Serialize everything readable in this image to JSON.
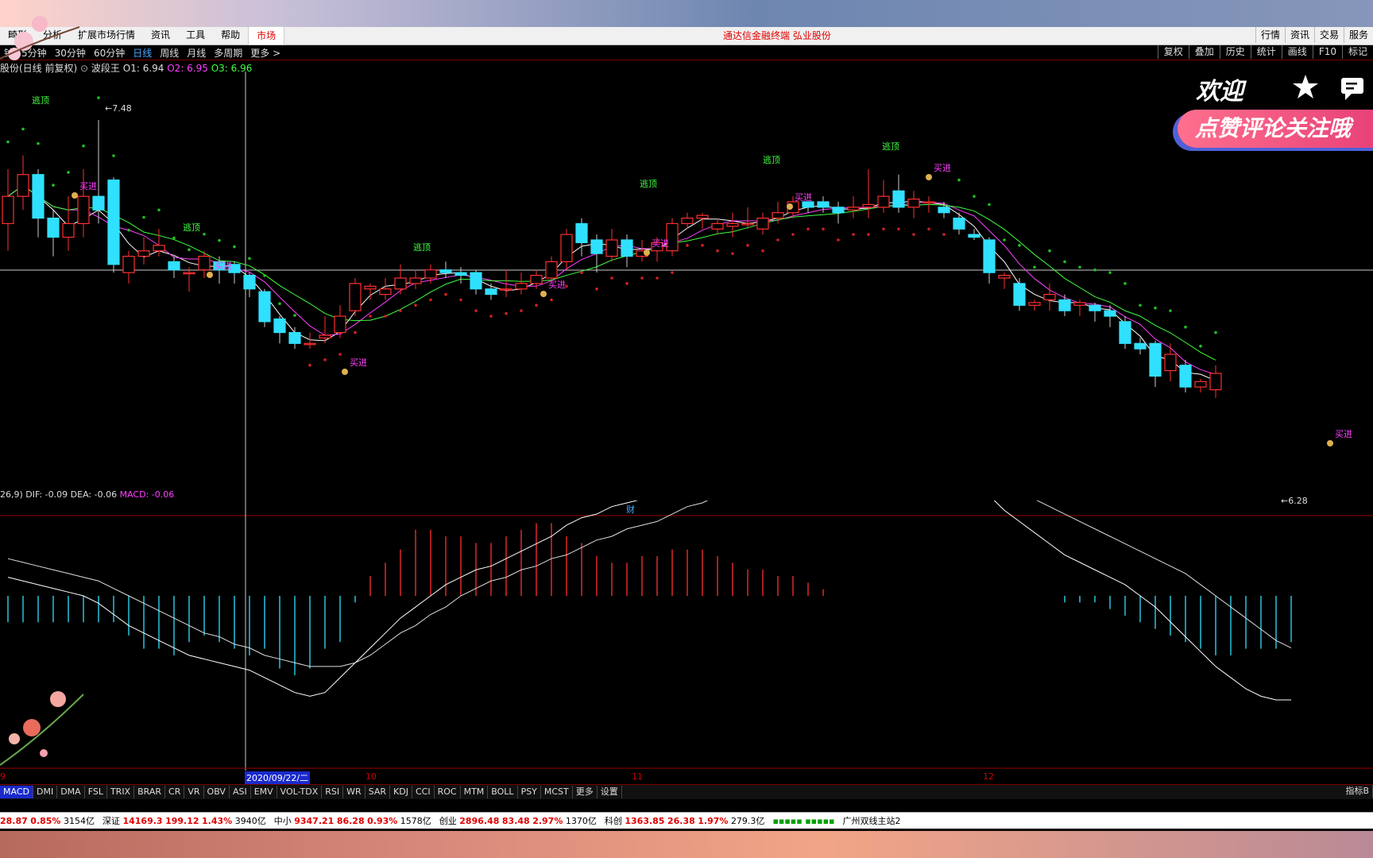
{
  "app": {
    "menu": [
      "系统",
      "分析",
      "扩展市场行情",
      "资讯",
      "工具",
      "帮助",
      "市场"
    ],
    "menu_visible": [
      "畸形",
      "分析",
      "扩展市场行情",
      "资讯",
      "工具",
      "帮助",
      "市场"
    ],
    "center_title": "通达信金融终端 弘业股份",
    "right_menu": [
      "行情",
      "资讯",
      "交易",
      "服务"
    ]
  },
  "periodbar": {
    "periods": [
      "1分钟",
      "5分钟",
      "30分钟",
      "60分钟",
      "日线",
      "周线",
      "月线",
      "多周期",
      "更多 >"
    ],
    "periods_visible": [
      "钟",
      "5分钟",
      "30分钟",
      "60分钟",
      "日线",
      "周线",
      "月线",
      "多周期",
      "更多 >"
    ],
    "active": "日线",
    "right": [
      "复权",
      "叠加",
      "历史",
      "统计",
      "画线",
      "F10",
      "标记"
    ]
  },
  "info": {
    "name": "股份(日线 前复权)",
    "indicator": "波段王",
    "o1_label": "O1: 6.94",
    "o2_label": "O2: 6.95",
    "o3_label": "O3: 6.96"
  },
  "chart_annotations": {
    "high_label": "7.48",
    "low_label": "6.28",
    "escape_top": "逃顶",
    "buy_in": "买进",
    "finance_marker": "财"
  },
  "macd": {
    "params": "26,9)",
    "dif": "DIF: -0.09",
    "dea": "DEA: -0.06",
    "macd": "MACD: -0.06"
  },
  "dates": {
    "selected": "2020/09/22/二",
    "month_10": "10",
    "month_11": "11",
    "month_12": "12",
    "left": "9"
  },
  "indicator_tabs": [
    "MACD",
    "DMI",
    "DMA",
    "FSL",
    "TRIX",
    "BRAR",
    "CR",
    "VR",
    "OBV",
    "ASI",
    "EMV",
    "VOL-TDX",
    "RSI",
    "WR",
    "SAR",
    "KDJ",
    "CCI",
    "ROC",
    "MTM",
    "BOLL",
    "PSY",
    "MCST",
    "更多",
    "设置"
  ],
  "indicator_active": "MACD",
  "indicator_right": "指标B",
  "status": [
    {
      "name": "",
      "value": "28.87",
      "pct": "0.85%",
      "amt": "3154亿"
    },
    {
      "name": "深证",
      "value": "14169.3",
      "chg": "199.12",
      "pct": "1.43%",
      "amt": "3940亿"
    },
    {
      "name": "中小",
      "value": "9347.21",
      "chg": "86.28",
      "pct": "0.93%",
      "amt": "1578亿"
    },
    {
      "name": "创业",
      "value": "2896.48",
      "chg": "83.48",
      "pct": "2.97%",
      "amt": "1370亿"
    },
    {
      "name": "科创",
      "value": "1363.85",
      "chg": "26.38",
      "pct": "1.97%",
      "amt": "279.3亿"
    }
  ],
  "status_site": "广州双线主站2",
  "overlay": {
    "welcome": "欢迎",
    "banner": "点赞评论关注哦"
  },
  "colors": {
    "up": "#ff3030",
    "down": "#30e0ff",
    "ma_white": "#ffffff",
    "ma_magenta": "#ff40ff",
    "ma_green": "#40ff40",
    "sar_green": "#20c020",
    "sar_red": "#d02020"
  },
  "chart_data": {
    "type": "candlestick",
    "price_range": [
      6.28,
      7.48
    ],
    "candles": [
      [
        7.1,
        7.2,
        7.0,
        7.3
      ],
      [
        7.2,
        7.28,
        7.15,
        7.35
      ],
      [
        7.28,
        7.12,
        7.05,
        7.3
      ],
      [
        7.12,
        7.05,
        6.98,
        7.15
      ],
      [
        7.05,
        7.1,
        7.0,
        7.2
      ],
      [
        7.1,
        7.2,
        7.05,
        7.3
      ],
      [
        7.2,
        7.15,
        7.1,
        7.48
      ],
      [
        7.26,
        6.95,
        6.92,
        7.27
      ],
      [
        6.92,
        6.98,
        6.88,
        7.0
      ],
      [
        6.98,
        7.0,
        6.95,
        7.05
      ],
      [
        7.0,
        7.02,
        6.98,
        7.08
      ],
      [
        6.96,
        6.93,
        6.9,
        6.98
      ],
      [
        6.92,
        6.92,
        6.85,
        6.94
      ],
      [
        6.93,
        6.98,
        6.9,
        7.0
      ],
      [
        6.96,
        6.93,
        6.88,
        6.98
      ],
      [
        6.95,
        6.92,
        6.88,
        6.96
      ],
      [
        6.91,
        6.86,
        6.83,
        6.92
      ],
      [
        6.85,
        6.74,
        6.72,
        6.86
      ],
      [
        6.75,
        6.7,
        6.66,
        6.76
      ],
      [
        6.7,
        6.66,
        6.64,
        6.72
      ],
      [
        6.66,
        6.66,
        6.64,
        6.7
      ],
      [
        6.68,
        6.69,
        6.66,
        6.76
      ],
      [
        6.7,
        6.76,
        6.68,
        6.8
      ],
      [
        6.78,
        6.88,
        6.76,
        6.9
      ],
      [
        6.86,
        6.87,
        6.82,
        6.88
      ],
      [
        6.84,
        6.86,
        6.82,
        6.9
      ],
      [
        6.86,
        6.9,
        6.84,
        6.95
      ],
      [
        6.88,
        6.9,
        6.86,
        6.93
      ],
      [
        6.9,
        6.93,
        6.88,
        6.95
      ],
      [
        6.93,
        6.92,
        6.9,
        6.96
      ],
      [
        6.92,
        6.91,
        6.88,
        6.94
      ],
      [
        6.92,
        6.86,
        6.84,
        6.93
      ],
      [
        6.86,
        6.84,
        6.82,
        6.88
      ],
      [
        6.86,
        6.86,
        6.83,
        6.93
      ],
      [
        6.86,
        6.88,
        6.84,
        6.92
      ],
      [
        6.88,
        6.91,
        6.86,
        6.93
      ],
      [
        6.9,
        6.96,
        6.88,
        6.98
      ],
      [
        6.96,
        7.06,
        6.93,
        7.08
      ],
      [
        7.1,
        7.03,
        6.98,
        7.12
      ],
      [
        7.04,
        6.99,
        6.92,
        7.06
      ],
      [
        6.98,
        7.04,
        6.96,
        7.08
      ],
      [
        7.04,
        6.98,
        6.94,
        7.06
      ],
      [
        6.98,
        7.0,
        6.96,
        7.04
      ],
      [
        7.0,
        7.03,
        6.96,
        7.05
      ],
      [
        7.0,
        7.1,
        6.98,
        7.12
      ],
      [
        7.1,
        7.12,
        7.08,
        7.14
      ],
      [
        7.12,
        7.13,
        7.08,
        7.14
      ],
      [
        7.08,
        7.1,
        7.06,
        7.12
      ],
      [
        7.09,
        7.1,
        7.05,
        7.14
      ],
      [
        7.1,
        7.1,
        7.08,
        7.16
      ],
      [
        7.08,
        7.12,
        7.06,
        7.14
      ],
      [
        7.12,
        7.14,
        7.1,
        7.18
      ],
      [
        7.14,
        7.18,
        7.12,
        7.2
      ],
      [
        7.18,
        7.16,
        7.14,
        7.18
      ],
      [
        7.18,
        7.16,
        7.14,
        7.2
      ],
      [
        7.16,
        7.14,
        7.1,
        7.18
      ],
      [
        7.15,
        7.16,
        7.12,
        7.2
      ],
      [
        7.16,
        7.17,
        7.12,
        7.3
      ],
      [
        7.16,
        7.2,
        7.14,
        7.26
      ],
      [
        7.22,
        7.16,
        7.14,
        7.28
      ],
      [
        7.16,
        7.19,
        7.12,
        7.22
      ],
      [
        7.18,
        7.18,
        7.14,
        7.2
      ],
      [
        7.16,
        7.14,
        7.12,
        7.18
      ],
      [
        7.12,
        7.08,
        7.06,
        7.14
      ],
      [
        7.06,
        7.05,
        7.04,
        7.08
      ],
      [
        7.04,
        6.92,
        6.88,
        7.05
      ],
      [
        6.9,
        6.91,
        6.86,
        6.92
      ],
      [
        6.88,
        6.8,
        6.78,
        6.9
      ],
      [
        6.8,
        6.81,
        6.78,
        6.82
      ],
      [
        6.82,
        6.84,
        6.78,
        6.88
      ],
      [
        6.82,
        6.78,
        6.76,
        6.84
      ],
      [
        6.8,
        6.81,
        6.76,
        6.82
      ],
      [
        6.8,
        6.78,
        6.74,
        6.81
      ],
      [
        6.78,
        6.76,
        6.72,
        6.8
      ],
      [
        6.74,
        6.66,
        6.64,
        6.76
      ],
      [
        6.66,
        6.64,
        6.62,
        6.68
      ],
      [
        6.66,
        6.54,
        6.5,
        6.67
      ],
      [
        6.56,
        6.62,
        6.52,
        6.66
      ],
      [
        6.58,
        6.5,
        6.48,
        6.6
      ],
      [
        6.5,
        6.52,
        6.48,
        6.53
      ],
      [
        6.49,
        6.55,
        6.46,
        6.58
      ]
    ],
    "macd_hist": [
      -0.04,
      -0.04,
      -0.04,
      -0.04,
      -0.04,
      -0.04,
      -0.04,
      -0.04,
      -0.06,
      -0.08,
      -0.08,
      -0.09,
      -0.07,
      -0.06,
      -0.07,
      -0.08,
      -0.09,
      -0.08,
      -0.11,
      -0.12,
      -0.11,
      -0.08,
      -0.07,
      -0.01,
      0.03,
      0.05,
      0.07,
      0.1,
      0.1,
      0.09,
      0.09,
      0.08,
      0.08,
      0.09,
      0.1,
      0.11,
      0.11,
      0.09,
      0.08,
      0.06,
      0.05,
      0.05,
      0.06,
      0.06,
      0.07,
      0.07,
      0.07,
      0.06,
      0.05,
      0.04,
      0.04,
      0.03,
      0.03,
      0.02,
      0.01,
      0.0,
      0.0,
      0.0,
      0.0,
      0.0,
      0.0,
      0.0,
      0.0,
      0.0,
      0.0,
      0.0,
      0.0,
      0.0,
      0.0,
      0.0,
      -0.01,
      -0.01,
      -0.01,
      -0.02,
      -0.03,
      -0.04,
      -0.05,
      -0.06,
      -0.07,
      -0.08,
      -0.09,
      -0.09,
      -0.08,
      -0.08,
      -0.08,
      -0.07
    ],
    "dif": [
      0.05,
      0.04,
      0.03,
      0.02,
      0.01,
      0.0,
      -0.02,
      -0.05,
      -0.08,
      -0.1,
      -0.12,
      -0.14,
      -0.16,
      -0.17,
      -0.18,
      -0.19,
      -0.2,
      -0.22,
      -0.24,
      -0.26,
      -0.27,
      -0.26,
      -0.22,
      -0.18,
      -0.14,
      -0.1,
      -0.06,
      -0.03,
      0.0,
      0.03,
      0.05,
      0.07,
      0.08,
      0.1,
      0.12,
      0.14,
      0.16,
      0.19,
      0.21,
      0.22,
      0.24,
      0.25,
      0.26,
      0.27,
      0.29,
      0.3,
      0.32,
      0.33,
      0.34,
      0.34,
      0.35,
      0.35,
      0.36,
      0.36,
      0.35,
      0.35,
      0.34,
      0.34,
      0.34,
      0.33,
      0.33,
      0.33,
      0.32,
      0.31,
      0.29,
      0.27,
      0.23,
      0.2,
      0.17,
      0.14,
      0.11,
      0.09,
      0.07,
      0.05,
      0.03,
      0.0,
      -0.03,
      -0.07,
      -0.11,
      -0.15,
      -0.19,
      -0.22,
      -0.25,
      -0.27,
      -0.28,
      -0.28
    ],
    "dea": [
      0.1,
      0.09,
      0.08,
      0.07,
      0.06,
      0.05,
      0.04,
      0.02,
      0.0,
      -0.02,
      -0.04,
      -0.06,
      -0.08,
      -0.1,
      -0.11,
      -0.13,
      -0.14,
      -0.16,
      -0.17,
      -0.18,
      -0.19,
      -0.19,
      -0.19,
      -0.18,
      -0.16,
      -0.13,
      -0.1,
      -0.08,
      -0.05,
      -0.03,
      0.0,
      0.02,
      0.04,
      0.05,
      0.07,
      0.08,
      0.1,
      0.11,
      0.13,
      0.15,
      0.16,
      0.18,
      0.19,
      0.2,
      0.22,
      0.24,
      0.25,
      0.27,
      0.28,
      0.29,
      0.3,
      0.31,
      0.32,
      0.33,
      0.34,
      0.35,
      0.35,
      0.35,
      0.35,
      0.34,
      0.34,
      0.34,
      0.33,
      0.33,
      0.32,
      0.31,
      0.3,
      0.28,
      0.26,
      0.24,
      0.22,
      0.2,
      0.18,
      0.16,
      0.14,
      0.12,
      0.1,
      0.08,
      0.06,
      0.03,
      0.0,
      -0.03,
      -0.06,
      -0.09,
      -0.12,
      -0.14
    ]
  }
}
